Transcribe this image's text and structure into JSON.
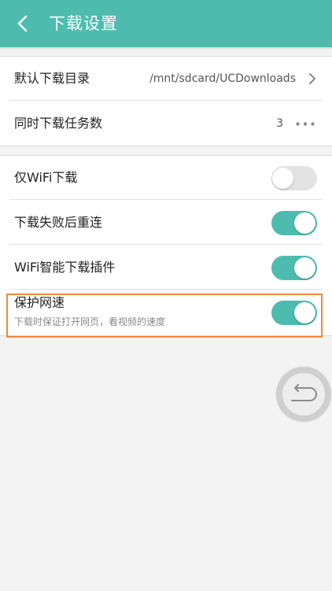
{
  "header": {
    "title": "下载设置",
    "back_icon": "back-arrow-icon",
    "background_color": "#4dbcaf"
  },
  "general": {
    "download_dir": {
      "label": "默认下载目录",
      "value": "/mnt/sdcard/UCDownloads",
      "icon": "chevron-right-icon"
    },
    "concurrent_tasks": {
      "label": "同时下载任务数",
      "value": "3",
      "icon": "more-dots-icon"
    }
  },
  "toggles": [
    {
      "label": "仅WiFi下载",
      "on": false
    },
    {
      "label": "下载失败后重连",
      "on": true
    },
    {
      "label": "WiFi智能下载插件",
      "on": true
    },
    {
      "label": "保护网速",
      "description": "下载时保证打开网页，看视频的速度",
      "on": true
    }
  ],
  "colors": {
    "accent": "#4dbcaf",
    "toggle_off": "#e3e3e3",
    "highlight": "#f08a35"
  },
  "floating_button": {
    "icon": "return-arrow-icon"
  }
}
